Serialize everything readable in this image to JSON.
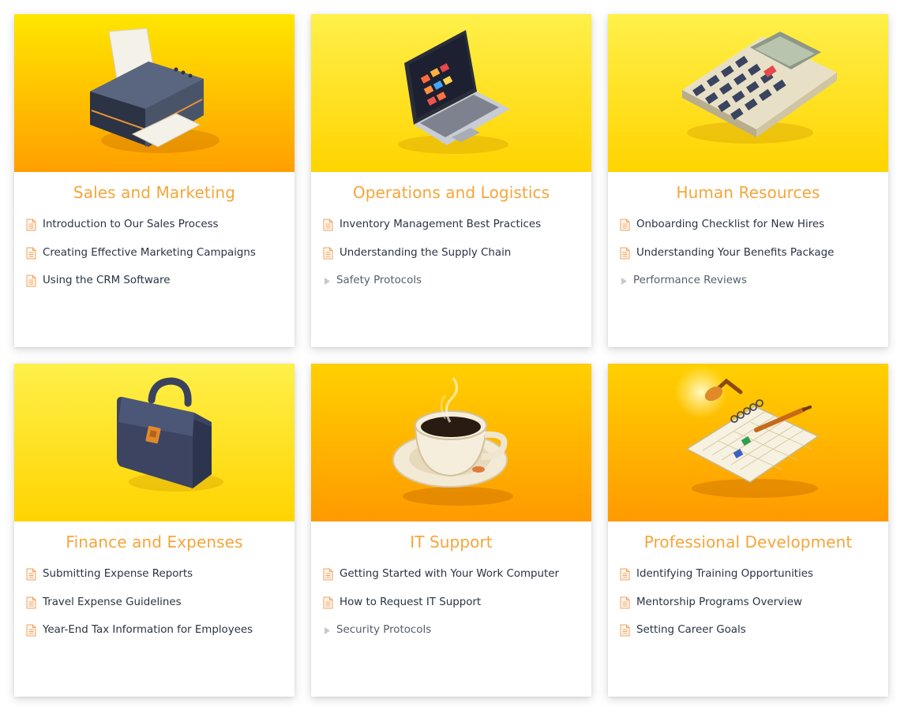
{
  "colors": {
    "accent": "#f5a53a",
    "item_text": "#2a3344",
    "icon_doc": "#f0a060",
    "caret": "#c4c8cf"
  },
  "cards": [
    {
      "title": "Sales and Marketing",
      "image": "printer-illustration",
      "items": [
        {
          "label": "Introduction to Our Sales Process",
          "icon": "document-icon"
        },
        {
          "label": "Creating Effective Marketing Campaigns",
          "icon": "document-icon"
        },
        {
          "label": "Using the CRM Software",
          "icon": "document-icon"
        }
      ]
    },
    {
      "title": "Operations and Logistics",
      "image": "laptop-illustration",
      "items": [
        {
          "label": "Inventory Management Best Practices",
          "icon": "document-icon"
        },
        {
          "label": "Understanding the Supply Chain",
          "icon": "document-icon"
        },
        {
          "label": "Safety Protocols",
          "icon": "caret-right-icon"
        }
      ]
    },
    {
      "title": "Human Resources",
      "image": "calculator-illustration",
      "items": [
        {
          "label": "Onboarding Checklist for New Hires",
          "icon": "document-icon"
        },
        {
          "label": "Understanding Your Benefits Package",
          "icon": "document-icon"
        },
        {
          "label": "Performance Reviews",
          "icon": "caret-right-icon"
        }
      ]
    },
    {
      "title": "Finance and Expenses",
      "image": "briefcase-illustration",
      "items": [
        {
          "label": "Submitting Expense Reports",
          "icon": "document-icon"
        },
        {
          "label": "Travel Expense Guidelines",
          "icon": "document-icon"
        },
        {
          "label": "Year-End Tax Information for Employees",
          "icon": "document-icon"
        }
      ]
    },
    {
      "title": "IT Support",
      "image": "coffee-cup-illustration",
      "items": [
        {
          "label": "Getting Started with Your Work Computer",
          "icon": "document-icon"
        },
        {
          "label": "How to Request IT Support",
          "icon": "document-icon"
        },
        {
          "label": "Security Protocols",
          "icon": "caret-right-icon"
        }
      ]
    },
    {
      "title": "Professional Development",
      "image": "notebook-illustration",
      "items": [
        {
          "label": "Identifying Training Opportunities",
          "icon": "document-icon"
        },
        {
          "label": "Mentorship Programs Overview",
          "icon": "document-icon"
        },
        {
          "label": "Setting Career Goals",
          "icon": "document-icon"
        }
      ]
    }
  ]
}
